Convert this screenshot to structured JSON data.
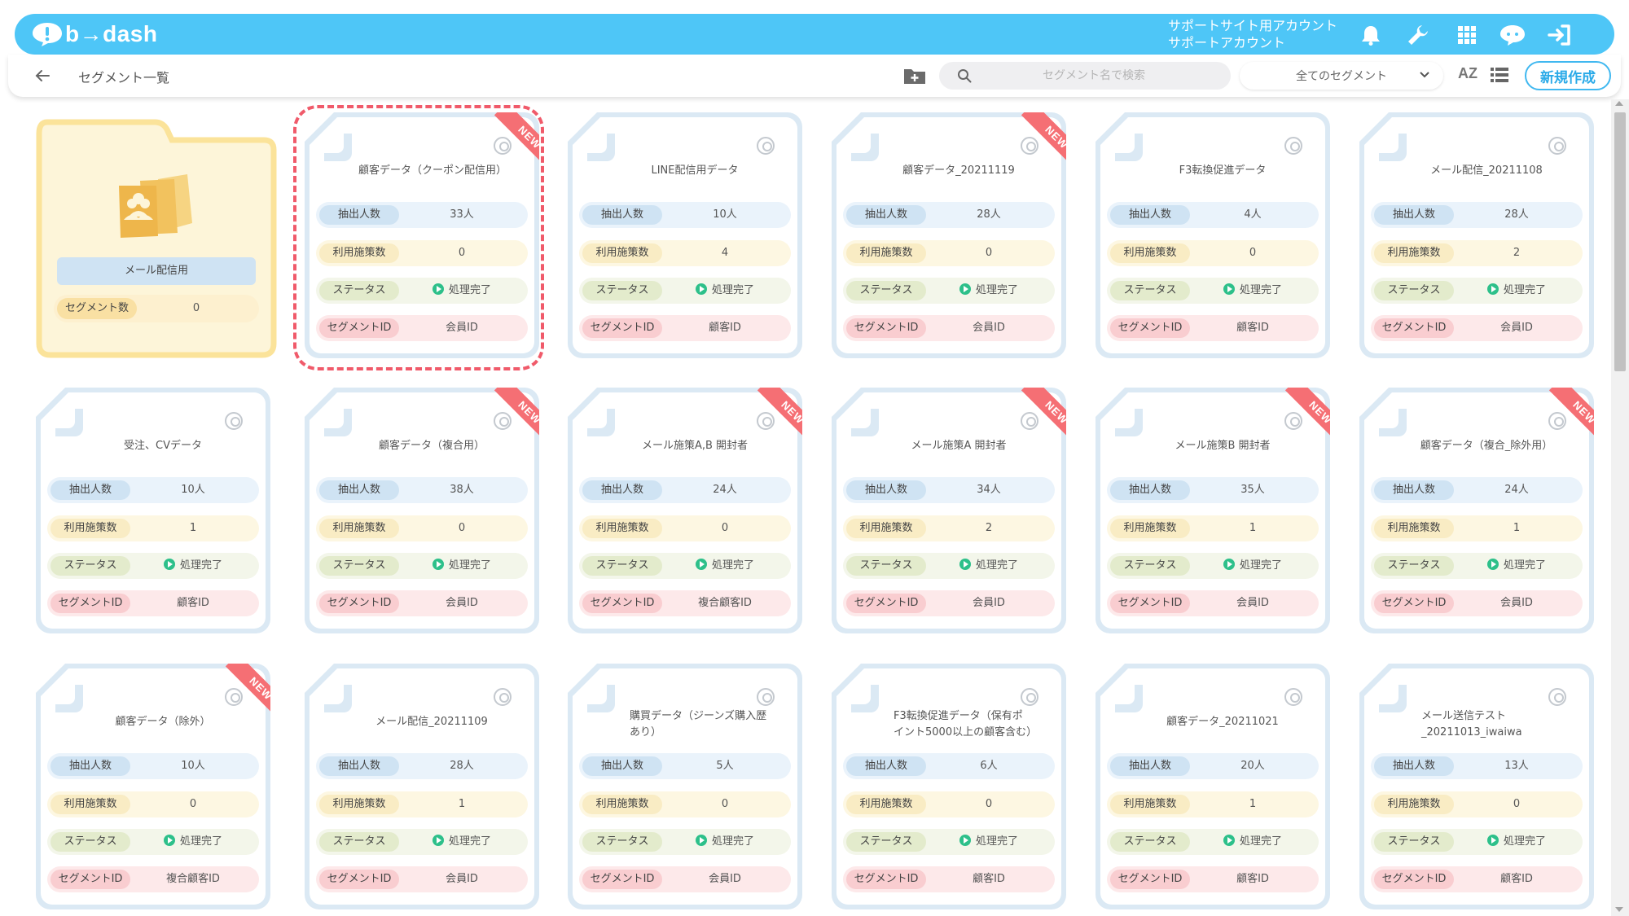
{
  "header": {
    "brand": "b→dash",
    "account_line1": "サポートサイト用アカウント",
    "account_line2": "サポートアカウント",
    "icons": [
      "bell-icon",
      "wrench-icon",
      "grid-icon",
      "support-icon",
      "logout-icon"
    ]
  },
  "subbar": {
    "breadcrumb": "セグメント一覧",
    "search_placeholder": "セグメント名で検索",
    "filter_selected": "全てのセグメント",
    "sort_label": "AZ",
    "new_button": "新規作成"
  },
  "labels": {
    "extract": "抽出人数",
    "usage": "利用施策数",
    "status": "ステータス",
    "segment_id": "セグメントID",
    "segment_count": "セグメント数"
  },
  "folder": {
    "name": "メール配信用",
    "segment_count": "0"
  },
  "cards": [
    {
      "title": "顧客データ（クーポン配信用）",
      "count": "33人",
      "usage": "0",
      "status": "処理完了",
      "id": "会員ID",
      "new": true
    },
    {
      "title": "LINE配信用データ",
      "count": "10人",
      "usage": "4",
      "status": "処理完了",
      "id": "顧客ID",
      "new": false
    },
    {
      "title": "顧客データ_20211119",
      "count": "28人",
      "usage": "0",
      "status": "処理完了",
      "id": "会員ID",
      "new": true
    },
    {
      "title": "F3転換促進データ",
      "count": "4人",
      "usage": "0",
      "status": "処理完了",
      "id": "顧客ID",
      "new": false
    },
    {
      "title": "メール配信_20211108",
      "count": "28人",
      "usage": "2",
      "status": "処理完了",
      "id": "会員ID",
      "new": false
    },
    {
      "title": "受注、CVデータ",
      "count": "10人",
      "usage": "1",
      "status": "処理完了",
      "id": "顧客ID",
      "new": false
    },
    {
      "title": "顧客データ（複合用）",
      "count": "38人",
      "usage": "0",
      "status": "処理完了",
      "id": "会員ID",
      "new": true
    },
    {
      "title": "メール施策A,B 開封者",
      "count": "24人",
      "usage": "0",
      "status": "処理完了",
      "id": "複合顧客ID",
      "new": true
    },
    {
      "title": "メール施策A 開封者",
      "count": "34人",
      "usage": "2",
      "status": "処理完了",
      "id": "会員ID",
      "new": true
    },
    {
      "title": "メール施策B 開封者",
      "count": "35人",
      "usage": "1",
      "status": "処理完了",
      "id": "会員ID",
      "new": true
    },
    {
      "title": "顧客データ（複合_除外用）",
      "count": "24人",
      "usage": "1",
      "status": "処理完了",
      "id": "会員ID",
      "new": true
    },
    {
      "title": "顧客データ（除外）",
      "count": "10人",
      "usage": "0",
      "status": "処理完了",
      "id": "複合顧客ID",
      "new": true
    },
    {
      "title": "メール配信_20211109",
      "count": "28人",
      "usage": "1",
      "status": "処理完了",
      "id": "会員ID",
      "new": false
    },
    {
      "title": "購買データ（ジーンズ購入歴あり）",
      "count": "5人",
      "usage": "0",
      "status": "処理完了",
      "id": "会員ID",
      "new": false
    },
    {
      "title": "F3転換促進データ（保有ポイント5000以上の顧客含む）",
      "count": "6人",
      "usage": "0",
      "status": "処理完了",
      "id": "顧客ID",
      "new": false
    },
    {
      "title": "顧客データ_20211021",
      "count": "20人",
      "usage": "1",
      "status": "処理完了",
      "id": "顧客ID",
      "new": false
    },
    {
      "title": "メール送信テスト_20211013_iwaiwa",
      "count": "13人",
      "usage": "0",
      "status": "処理完了",
      "id": "顧客ID",
      "new": false
    }
  ],
  "colors": {
    "brand": "#4ec6f7",
    "new_ribbon": "#f56f74",
    "status_ok": "#2dc08a",
    "folder": "#fbe39a"
  }
}
